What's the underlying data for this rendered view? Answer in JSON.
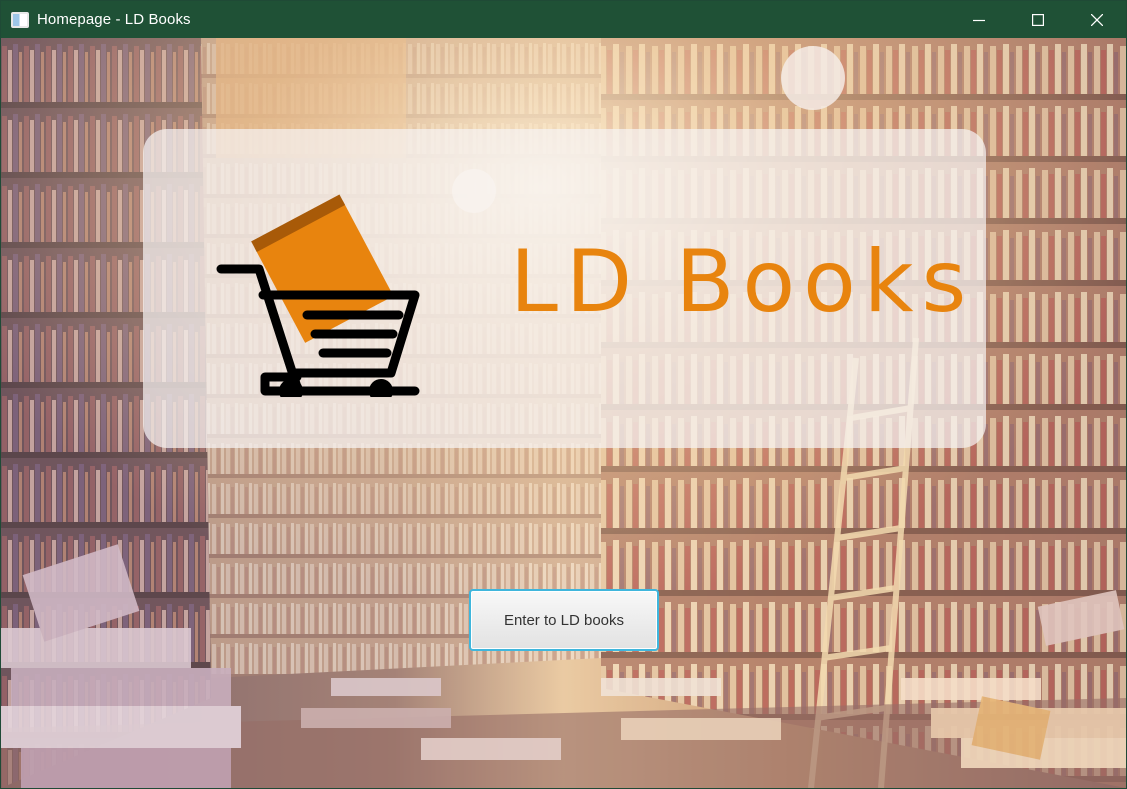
{
  "window": {
    "title": "Homepage - LD Books",
    "controls": [
      "minimize",
      "maximize",
      "close"
    ]
  },
  "hero": {
    "brand_name": "LD Books",
    "logo_icon": "shopping-cart-with-book-icon"
  },
  "actions": {
    "enter_label": "Enter to LD books"
  },
  "colors": {
    "titlebar": "#1f5136",
    "brand_orange": "#e8840e",
    "button_focus_border": "#3fb6dc"
  }
}
